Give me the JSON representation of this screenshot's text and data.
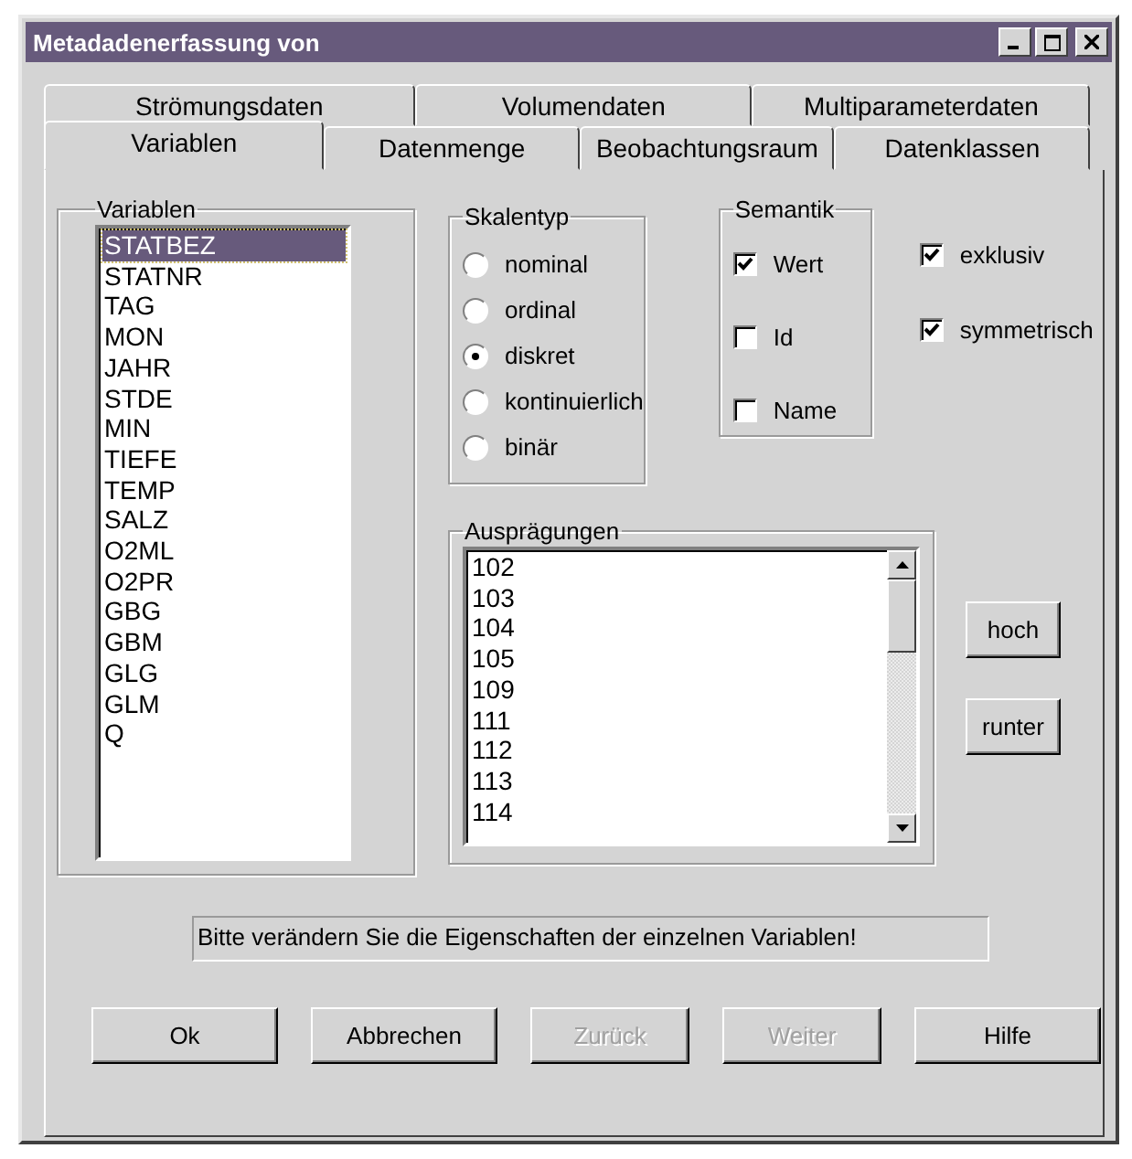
{
  "window": {
    "title": "Metadadenerfassung von"
  },
  "tab_rows": [
    [
      {
        "label": "Strömungsdaten",
        "selected": false
      },
      {
        "label": "Volumendaten",
        "selected": false
      },
      {
        "label": "Multiparameterdaten",
        "selected": false
      }
    ],
    [
      {
        "label": "Variablen",
        "selected": true
      },
      {
        "label": "Datenmenge",
        "selected": false
      },
      {
        "label": "Beobachtungsraum",
        "selected": false
      },
      {
        "label": "Datenklassen",
        "selected": false
      }
    ]
  ],
  "variables": {
    "label": "Variablen",
    "items": [
      {
        "name": "STATBEZ",
        "selected": true
      },
      {
        "name": "STATNR",
        "selected": false
      },
      {
        "name": "TAG",
        "selected": false
      },
      {
        "name": "MON",
        "selected": false
      },
      {
        "name": "JAHR",
        "selected": false
      },
      {
        "name": "STDE",
        "selected": false
      },
      {
        "name": "MIN",
        "selected": false
      },
      {
        "name": "TIEFE",
        "selected": false
      },
      {
        "name": "TEMP",
        "selected": false
      },
      {
        "name": "SALZ",
        "selected": false
      },
      {
        "name": "O2ML",
        "selected": false
      },
      {
        "name": "O2PR",
        "selected": false
      },
      {
        "name": "GBG",
        "selected": false
      },
      {
        "name": "GBM",
        "selected": false
      },
      {
        "name": "GLG",
        "selected": false
      },
      {
        "name": "GLM",
        "selected": false
      },
      {
        "name": "Q",
        "selected": false
      }
    ]
  },
  "scale_type": {
    "label": "Skalentyp",
    "options": [
      {
        "label": "nominal",
        "selected": false
      },
      {
        "label": "ordinal",
        "selected": false
      },
      {
        "label": "diskret",
        "selected": true
      },
      {
        "label": "kontinuierlich",
        "selected": false
      },
      {
        "label": "binär",
        "selected": false
      }
    ]
  },
  "semantics": {
    "label": "Semantik",
    "options": [
      {
        "label": "Wert",
        "checked": true
      },
      {
        "label": "Id",
        "checked": false
      },
      {
        "label": "Name",
        "checked": false
      }
    ]
  },
  "flags": [
    {
      "label": "exklusiv",
      "checked": true
    },
    {
      "label": "symmetrisch",
      "checked": true
    }
  ],
  "values": {
    "label": "Ausprägungen",
    "items": [
      "102",
      "103",
      "104",
      "105",
      "109",
      "111",
      "112",
      "113",
      "114"
    ]
  },
  "order_buttons": [
    "hoch",
    "runter"
  ],
  "message": "Bitte verändern Sie die Eigenschaften der einzelnen Variablen!",
  "buttons": [
    {
      "label": "Ok",
      "disabled": false
    },
    {
      "label": "Abbrechen",
      "disabled": false
    },
    {
      "label": "Zurück",
      "disabled": true
    },
    {
      "label": "Weiter",
      "disabled": true
    },
    {
      "label": "Hilfe",
      "disabled": false
    }
  ]
}
